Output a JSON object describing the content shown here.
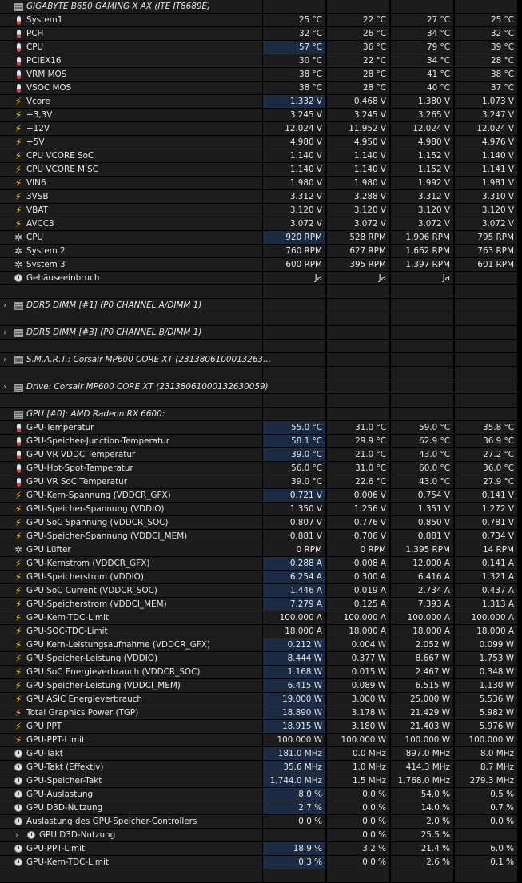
{
  "groups": [
    {
      "title": "GIGABYTE B650 GAMING X AX (ITE IT8689E)",
      "expanded": true,
      "rows": [
        {
          "icon": "thermometer-icon",
          "label": "System1",
          "cur": "25 °C",
          "min": "22 °C",
          "max": "27 °C",
          "avg": "25 °C",
          "hl": false
        },
        {
          "icon": "thermometer-icon",
          "label": "PCH",
          "cur": "32 °C",
          "min": "26 °C",
          "max": "34 °C",
          "avg": "32 °C",
          "hl": false
        },
        {
          "icon": "thermometer-icon",
          "label": "CPU",
          "cur": "57 °C",
          "min": "36 °C",
          "max": "79 °C",
          "avg": "39 °C",
          "hl": true
        },
        {
          "icon": "thermometer-icon",
          "label": "PCIEX16",
          "cur": "30 °C",
          "min": "22 °C",
          "max": "34 °C",
          "avg": "28 °C",
          "hl": false
        },
        {
          "icon": "thermometer-icon",
          "label": "VRM MOS",
          "cur": "38 °C",
          "min": "28 °C",
          "max": "41 °C",
          "avg": "38 °C",
          "hl": false
        },
        {
          "icon": "thermometer-icon",
          "label": "VSOC MOS",
          "cur": "38 °C",
          "min": "28 °C",
          "max": "40 °C",
          "avg": "37 °C",
          "hl": false
        },
        {
          "icon": "lightning-icon",
          "label": "Vcore",
          "cur": "1.332 V",
          "min": "0.468 V",
          "max": "1.380 V",
          "avg": "1.073 V",
          "hl": true
        },
        {
          "icon": "lightning-icon",
          "label": "+3,3V",
          "cur": "3.245 V",
          "min": "3.245 V",
          "max": "3.265 V",
          "avg": "3.247 V",
          "hl": false
        },
        {
          "icon": "lightning-icon",
          "label": "+12V",
          "cur": "12.024 V",
          "min": "11.952 V",
          "max": "12.024 V",
          "avg": "12.024 V",
          "hl": false
        },
        {
          "icon": "lightning-icon",
          "label": "+5V",
          "cur": "4.980 V",
          "min": "4.950 V",
          "max": "4.980 V",
          "avg": "4.976 V",
          "hl": false
        },
        {
          "icon": "lightning-icon",
          "label": "CPU VCORE SoC",
          "cur": "1.140 V",
          "min": "1.140 V",
          "max": "1.152 V",
          "avg": "1.140 V",
          "hl": false
        },
        {
          "icon": "lightning-icon",
          "label": "CPU VCORE MISC",
          "cur": "1.140 V",
          "min": "1.140 V",
          "max": "1.152 V",
          "avg": "1.141 V",
          "hl": false
        },
        {
          "icon": "lightning-icon",
          "label": "VIN6",
          "cur": "1.980 V",
          "min": "1.980 V",
          "max": "1.992 V",
          "avg": "1.981 V",
          "hl": false
        },
        {
          "icon": "lightning-icon",
          "label": "3VSB",
          "cur": "3.312 V",
          "min": "3.288 V",
          "max": "3.312 V",
          "avg": "3.310 V",
          "hl": false
        },
        {
          "icon": "lightning-icon",
          "label": "VBAT",
          "cur": "3.120 V",
          "min": "3.120 V",
          "max": "3.120 V",
          "avg": "3.120 V",
          "hl": false
        },
        {
          "icon": "lightning-icon",
          "label": "AVCC3",
          "cur": "3.072 V",
          "min": "3.072 V",
          "max": "3.072 V",
          "avg": "3.072 V",
          "hl": false
        },
        {
          "icon": "fan-icon",
          "label": "CPU",
          "cur": "920 RPM",
          "min": "528 RPM",
          "max": "1,906 RPM",
          "avg": "795 RPM",
          "hl": true
        },
        {
          "icon": "fan-icon",
          "label": "System 2",
          "cur": "760 RPM",
          "min": "627 RPM",
          "max": "1,662 RPM",
          "avg": "763 RPM",
          "hl": false
        },
        {
          "icon": "fan-icon",
          "label": "System 3",
          "cur": "600 RPM",
          "min": "395 RPM",
          "max": "1,397 RPM",
          "avg": "601 RPM",
          "hl": false
        },
        {
          "icon": "clock-icon",
          "label": "Gehäuseeinbruch",
          "cur": "Ja",
          "min": "Ja",
          "max": "Ja",
          "avg": "",
          "hl": false
        }
      ]
    },
    {
      "title": "DDR5 DIMM [#1] (P0 CHANNEL A/DIMM 1)",
      "expanded": false,
      "rows": []
    },
    {
      "title": "DDR5 DIMM [#3] (P0 CHANNEL B/DIMM 1)",
      "expanded": false,
      "rows": []
    },
    {
      "title": "S.M.A.R.T.: Corsair MP600 CORE XT (2313806100013263...",
      "expanded": false,
      "rows": []
    },
    {
      "title": "Drive: Corsair MP600 CORE XT (23138061000132630059)",
      "expanded": false,
      "rows": []
    },
    {
      "title": "GPU [#0]: AMD Radeon RX 6600:",
      "expanded": true,
      "rows": [
        {
          "icon": "thermometer-icon",
          "label": "GPU-Temperatur",
          "cur": "55.0 °C",
          "min": "31.0 °C",
          "max": "59.0 °C",
          "avg": "35.8 °C",
          "hl": true
        },
        {
          "icon": "thermometer-icon",
          "label": "GPU-Speicher-Junction-Temperatur",
          "cur": "58.1 °C",
          "min": "29.9 °C",
          "max": "62.9 °C",
          "avg": "36.9 °C",
          "hl": true
        },
        {
          "icon": "thermometer-icon",
          "label": "GPU VR VDDC Temperatur",
          "cur": "39.0 °C",
          "min": "21.0 °C",
          "max": "43.0 °C",
          "avg": "27.2 °C",
          "hl": true
        },
        {
          "icon": "thermometer-icon",
          "label": "GPU-Hot-Spot-Temperatur",
          "cur": "56.0 °C",
          "min": "31.0 °C",
          "max": "60.0 °C",
          "avg": "36.0 °C",
          "hl": false
        },
        {
          "icon": "thermometer-icon",
          "label": "GPU VR SoC Temperatur",
          "cur": "39.0 °C",
          "min": "22.6 °C",
          "max": "43.0 °C",
          "avg": "27.9 °C",
          "hl": false
        },
        {
          "icon": "lightning-icon",
          "label": "GPU-Kern-Spannung (VDDCR_GFX)",
          "cur": "0.721 V",
          "min": "0.006 V",
          "max": "0.754 V",
          "avg": "0.141 V",
          "hl": true
        },
        {
          "icon": "lightning-icon",
          "label": "GPU-Speicher-Spannung (VDDIO)",
          "cur": "1.350 V",
          "min": "1.256 V",
          "max": "1.351 V",
          "avg": "1.272 V",
          "hl": false
        },
        {
          "icon": "lightning-icon",
          "label": "GPU SoC Spannung (VDDCR_SOC)",
          "cur": "0.807 V",
          "min": "0.776 V",
          "max": "0.850 V",
          "avg": "0.781 V",
          "hl": false
        },
        {
          "icon": "lightning-icon",
          "label": "GPU-Speicher-Spannung (VDDCI_MEM)",
          "cur": "0.881 V",
          "min": "0.706 V",
          "max": "0.881 V",
          "avg": "0.734 V",
          "hl": false
        },
        {
          "icon": "fan-icon",
          "label": "GPU Lüfter",
          "cur": "0 RPM",
          "min": "0 RPM",
          "max": "1,395 RPM",
          "avg": "14 RPM",
          "hl": false
        },
        {
          "icon": "lightning-icon",
          "label": "GPU-Kernstrom (VDDCR_GFX)",
          "cur": "0.288 A",
          "min": "0.008 A",
          "max": "12.000 A",
          "avg": "0.141 A",
          "hl": true
        },
        {
          "icon": "lightning-icon",
          "label": "GPU-Speicherstrom (VDDIO)",
          "cur": "6.254 A",
          "min": "0.300 A",
          "max": "6.416 A",
          "avg": "1.321 A",
          "hl": true
        },
        {
          "icon": "lightning-icon",
          "label": "GPU SoC Current (VDDCR_SOC)",
          "cur": "1.446 A",
          "min": "0.019 A",
          "max": "2.734 A",
          "avg": "0.437 A",
          "hl": true
        },
        {
          "icon": "lightning-icon",
          "label": "GPU-Speicherstrom (VDDCI_MEM)",
          "cur": "7.279 A",
          "min": "0.125 A",
          "max": "7.393 A",
          "avg": "1.313 A",
          "hl": true
        },
        {
          "icon": "lightning-icon",
          "label": "GPU-Kern-TDC-Limit",
          "cur": "100.000 A",
          "min": "100.000 A",
          "max": "100.000 A",
          "avg": "100.000 A",
          "hl": false
        },
        {
          "icon": "lightning-icon",
          "label": "GPU-SOC-TDC-Limit",
          "cur": "18.000 A",
          "min": "18.000 A",
          "max": "18.000 A",
          "avg": "18.000 A",
          "hl": false
        },
        {
          "icon": "lightning-icon",
          "label": "GPU Kern-Leistungsaufnahme (VDDCR_GFX)",
          "cur": "0.212 W",
          "min": "0.004 W",
          "max": "2.052 W",
          "avg": "0.099 W",
          "hl": true
        },
        {
          "icon": "lightning-icon",
          "label": "GPU-Speicher-Leistung (VDDIO)",
          "cur": "8.444 W",
          "min": "0.377 W",
          "max": "8.667 W",
          "avg": "1.753 W",
          "hl": true
        },
        {
          "icon": "lightning-icon",
          "label": "GPU SoC Energieverbrauch (VDDCR_SOC)",
          "cur": "1.168 W",
          "min": "0.015 W",
          "max": "2.467 W",
          "avg": "0.348 W",
          "hl": true
        },
        {
          "icon": "lightning-icon",
          "label": "GPU-Speicher-Leistung (VDDCI_MEM)",
          "cur": "6.415 W",
          "min": "0.089 W",
          "max": "6.515 W",
          "avg": "1.130 W",
          "hl": true
        },
        {
          "icon": "lightning-icon",
          "label": "GPU ASIC Energieverbrauch",
          "cur": "19.000 W",
          "min": "3.000 W",
          "max": "25.000 W",
          "avg": "5.536 W",
          "hl": true
        },
        {
          "icon": "lightning-icon",
          "label": "Total Graphics Power (TGP)",
          "cur": "18.890 W",
          "min": "3.178 W",
          "max": "21.429 W",
          "avg": "5.982 W",
          "hl": true
        },
        {
          "icon": "lightning-icon",
          "label": "GPU PPT",
          "cur": "18.915 W",
          "min": "3.180 W",
          "max": "21.403 W",
          "avg": "5.976 W",
          "hl": true
        },
        {
          "icon": "lightning-icon",
          "label": "GPU-PPT-Limit",
          "cur": "100.000 W",
          "min": "100.000 W",
          "max": "100.000 W",
          "avg": "100.000 W",
          "hl": false
        },
        {
          "icon": "clock-icon",
          "label": "GPU-Takt",
          "cur": "181.0 MHz",
          "min": "0.0 MHz",
          "max": "897.0 MHz",
          "avg": "8.0 MHz",
          "hl": true
        },
        {
          "icon": "clock-icon",
          "label": "GPU-Takt (Effektiv)",
          "cur": "35.6 MHz",
          "min": "1.0 MHz",
          "max": "414.3 MHz",
          "avg": "8.7 MHz",
          "hl": true
        },
        {
          "icon": "clock-icon",
          "label": "GPU-Speicher-Takt",
          "cur": "1,744.0 MHz",
          "min": "1.5 MHz",
          "max": "1,768.0 MHz",
          "avg": "279.3 MHz",
          "hl": true
        },
        {
          "icon": "clock-icon",
          "label": "GPU-Auslastung",
          "cur": "8.0 %",
          "min": "0.0 %",
          "max": "54.0 %",
          "avg": "0.5 %",
          "hl": true
        },
        {
          "icon": "clock-icon",
          "label": "GPU D3D-Nutzung",
          "cur": "2.7 %",
          "min": "0.0 %",
          "max": "14.0 %",
          "avg": "0.7 %",
          "hl": true
        },
        {
          "icon": "clock-icon",
          "label": "Auslastung des GPU-Speicher-Controllers",
          "cur": "0.0 %",
          "min": "0.0 %",
          "max": "2.0 %",
          "avg": "0.0 %",
          "hl": false
        },
        {
          "icon": "clock-icon",
          "label": "GPU D3D-Nutzung",
          "cur": "",
          "min": "0.0 %",
          "max": "25.5 %",
          "avg": "",
          "hl": false,
          "sub": true
        },
        {
          "icon": "clock-icon",
          "label": "GPU-PPT-Limit",
          "cur": "18.9 %",
          "min": "3.2 %",
          "max": "21.4 %",
          "avg": "6.0 %",
          "hl": true
        },
        {
          "icon": "clock-icon",
          "label": "GPU-Kern-TDC-Limit",
          "cur": "0.3 %",
          "min": "0.0 %",
          "max": "2.6 %",
          "avg": "0.1 %",
          "hl": true
        }
      ]
    }
  ]
}
